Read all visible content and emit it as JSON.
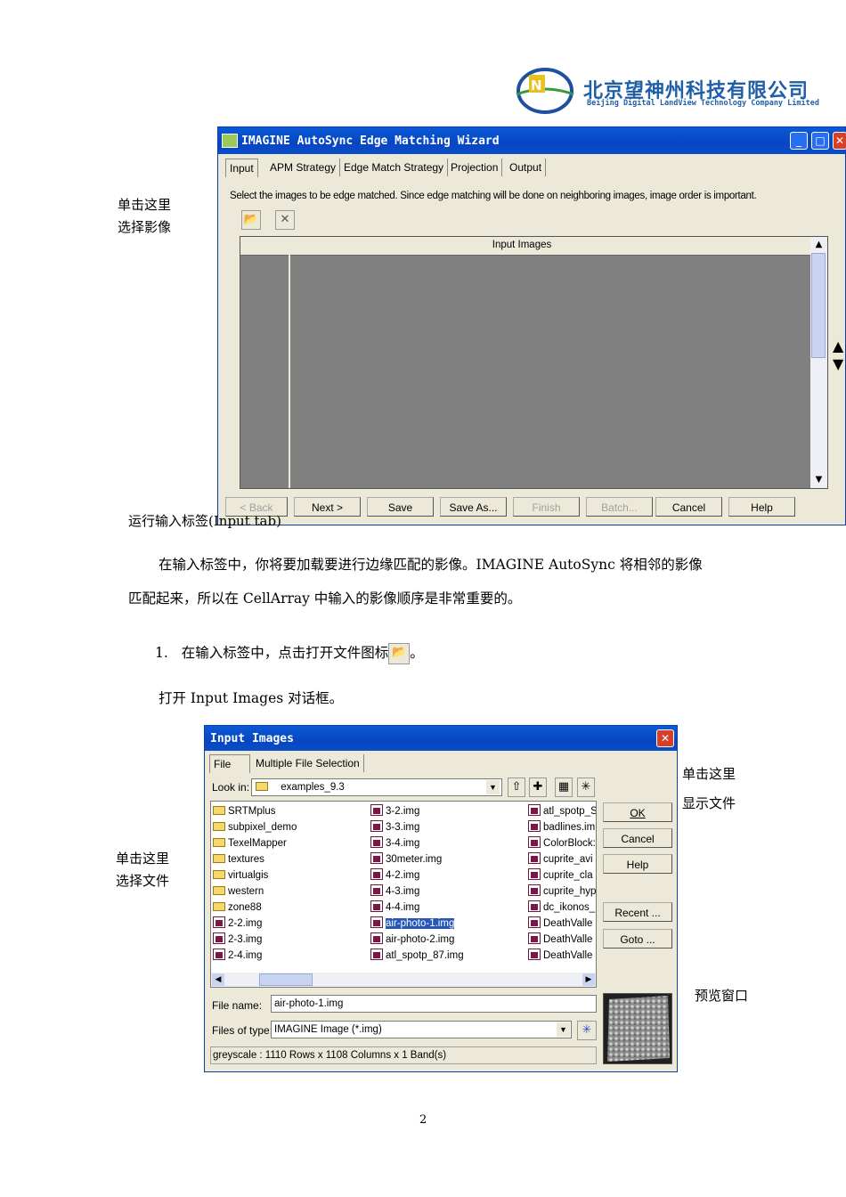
{
  "logo": {
    "cn": "北京望神州科技有限公司",
    "en": "Beijing Digital LandView Technology Company Limited"
  },
  "notes": {
    "left1": [
      "单击这里",
      "选择影像"
    ],
    "left2": [
      "单击这里",
      "选择文件"
    ],
    "right1": [
      "单击这里",
      "显示文件"
    ],
    "preview": "预览窗口"
  },
  "wizard": {
    "title": "IMAGINE AutoSync Edge Matching Wizard",
    "tabs": [
      "Input",
      "APM Strategy",
      "Edge Match Strategy",
      "Projection",
      "Output"
    ],
    "instruction": "Select the images to be edge matched.  Since edge matching will be done on neighboring images, image order is important.",
    "column_header": "Input Images",
    "buttons": {
      "back": "< Back",
      "next": "Next >",
      "save": "Save",
      "save_as": "Save As...",
      "finish": "Finish",
      "batch": "Batch...",
      "cancel": "Cancel",
      "help": "Help"
    }
  },
  "caption_run": "运行输入标签(Input tab)",
  "paragraph1": "在输入标签中，你将要加载要进行边缘匹配的影像。IMAGINE AutoSync 将相邻的影像",
  "paragraph2": "匹配起来，所以在 CellArray 中输入的影像顺序是非常重要的。",
  "step1": {
    "num": "1.",
    "text": "在输入标签中，点击打开文件图标",
    "end": "。"
  },
  "open_line": "打开 Input Images 对话框。",
  "dialog": {
    "title": "Input Images",
    "tabs": [
      "File",
      "Multiple File Selection"
    ],
    "look_in_label": "Look in:",
    "look_in_value": "examples_9.3",
    "col1": [
      "SRTMplus",
      "subpixel_demo",
      "TexelMapper",
      "textures",
      "virtualgis",
      "western",
      "zone88",
      "2-2.img",
      "2-3.img",
      "2-4.img"
    ],
    "col2": [
      "3-2.img",
      "3-3.img",
      "3-4.img",
      "30meter.img",
      "4-2.img",
      "4-3.img",
      "4-4.img",
      "air-photo-1.img",
      "air-photo-2.img",
      "atl_spotp_87.img"
    ],
    "col3": [
      "atl_spotp_S",
      "badlines.im",
      "ColorBlock:",
      "cuprite_avi",
      "cuprite_cla",
      "cuprite_hyp",
      "dc_ikonos_",
      "DeathValle",
      "DeathValle",
      "DeathValle"
    ],
    "buttons": {
      "ok": "OK",
      "cancel": "Cancel",
      "help": "Help",
      "recent": "Recent ...",
      "goto": "Goto ..."
    },
    "file_name_label": "File name:",
    "file_name_value": "air-photo-1.img",
    "file_type_label": "Files of type:",
    "file_type_value": "IMAGINE Image (*.img)",
    "status": "greyscale : 1110 Rows x 1108 Columns x 1 Band(s)"
  },
  "page_number": "2"
}
